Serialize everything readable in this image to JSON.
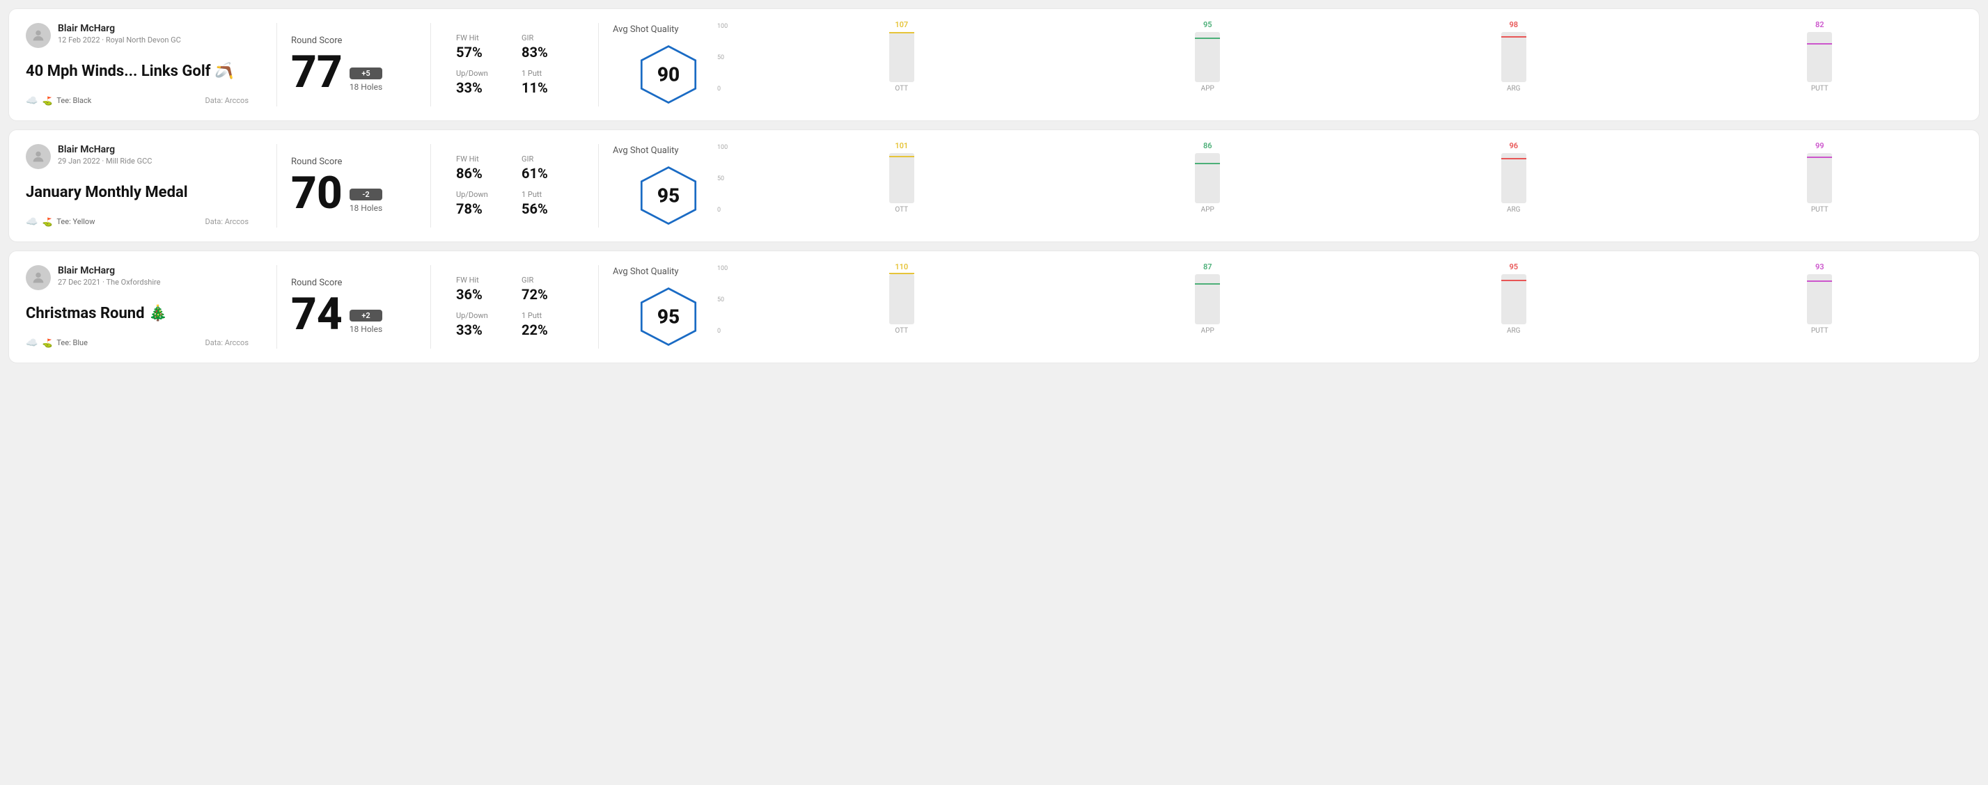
{
  "rounds": [
    {
      "id": "round-1",
      "user": {
        "name": "Blair McHarg",
        "date": "12 Feb 2022",
        "course": "Royal North Devon GC"
      },
      "title": "40 Mph Winds... Links Golf 🪃",
      "tee": "Black",
      "data_source": "Data: Arccos",
      "score": {
        "label": "Round Score",
        "value": "77",
        "diff": "+5",
        "holes": "18 Holes"
      },
      "stats": {
        "fw_hit_label": "FW Hit",
        "fw_hit_value": "57%",
        "gir_label": "GIR",
        "gir_value": "83%",
        "updown_label": "Up/Down",
        "updown_value": "33%",
        "putt_label": "1 Putt",
        "putt_value": "11%"
      },
      "quality": {
        "label": "Avg Shot Quality",
        "value": "90"
      },
      "chart": {
        "bars": [
          {
            "label": "OTT",
            "value": 107,
            "color": "#e6c43a",
            "max": 110
          },
          {
            "label": "APP",
            "value": 95,
            "color": "#4caf78",
            "max": 110
          },
          {
            "label": "ARG",
            "value": 98,
            "color": "#e85555",
            "max": 110
          },
          {
            "label": "PUTT",
            "value": 82,
            "color": "#cc55cc",
            "max": 110
          }
        ]
      }
    },
    {
      "id": "round-2",
      "user": {
        "name": "Blair McHarg",
        "date": "29 Jan 2022",
        "course": "Mill Ride GCC"
      },
      "title": "January Monthly Medal",
      "tee": "Yellow",
      "data_source": "Data: Arccos",
      "score": {
        "label": "Round Score",
        "value": "70",
        "diff": "-2",
        "holes": "18 Holes"
      },
      "stats": {
        "fw_hit_label": "FW Hit",
        "fw_hit_value": "86%",
        "gir_label": "GIR",
        "gir_value": "61%",
        "updown_label": "Up/Down",
        "updown_value": "78%",
        "putt_label": "1 Putt",
        "putt_value": "56%"
      },
      "quality": {
        "label": "Avg Shot Quality",
        "value": "95"
      },
      "chart": {
        "bars": [
          {
            "label": "OTT",
            "value": 101,
            "color": "#e6c43a",
            "max": 110
          },
          {
            "label": "APP",
            "value": 86,
            "color": "#4caf78",
            "max": 110
          },
          {
            "label": "ARG",
            "value": 96,
            "color": "#e85555",
            "max": 110
          },
          {
            "label": "PUTT",
            "value": 99,
            "color": "#cc55cc",
            "max": 110
          }
        ]
      }
    },
    {
      "id": "round-3",
      "user": {
        "name": "Blair McHarg",
        "date": "27 Dec 2021",
        "course": "The Oxfordshire"
      },
      "title": "Christmas Round 🎄",
      "tee": "Blue",
      "data_source": "Data: Arccos",
      "score": {
        "label": "Round Score",
        "value": "74",
        "diff": "+2",
        "holes": "18 Holes"
      },
      "stats": {
        "fw_hit_label": "FW Hit",
        "fw_hit_value": "36%",
        "gir_label": "GIR",
        "gir_value": "72%",
        "updown_label": "Up/Down",
        "updown_value": "33%",
        "putt_label": "1 Putt",
        "putt_value": "22%"
      },
      "quality": {
        "label": "Avg Shot Quality",
        "value": "95"
      },
      "chart": {
        "bars": [
          {
            "label": "OTT",
            "value": 110,
            "color": "#e6c43a",
            "max": 115
          },
          {
            "label": "APP",
            "value": 87,
            "color": "#4caf78",
            "max": 115
          },
          {
            "label": "ARG",
            "value": 95,
            "color": "#e85555",
            "max": 115
          },
          {
            "label": "PUTT",
            "value": 93,
            "color": "#cc55cc",
            "max": 115
          }
        ]
      }
    }
  ],
  "y_axis_labels": [
    "100",
    "50",
    "0"
  ]
}
